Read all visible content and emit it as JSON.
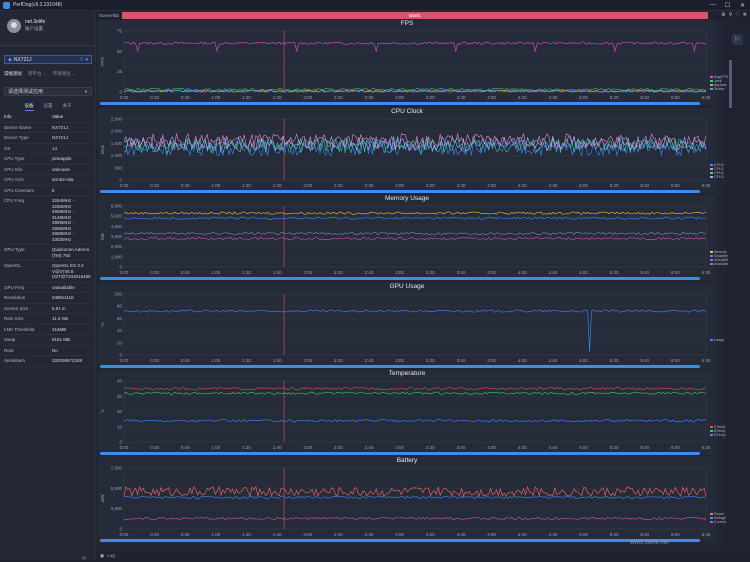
{
  "window": {
    "title": "PerfDog(v9.3.231048)",
    "minimize": "—",
    "maximize": "☐",
    "close": "✕"
  },
  "user": {
    "name": "net.3elife",
    "account": "账户设置"
  },
  "device": {
    "name": "NX721J"
  },
  "mode_tabs": [
    "常规测试",
    "跨平台 ...",
    "环境测试 ..."
  ],
  "app_select": {
    "placeholder": "请选择测试应用"
  },
  "info_tabs": [
    "设备",
    "设置",
    "关于"
  ],
  "info_header": {
    "k": "Info",
    "v": "Value"
  },
  "info_rows": [
    {
      "k": "Device Name",
      "v": "NX721J"
    },
    {
      "k": "Device Type",
      "v": "NX721J"
    },
    {
      "k": "OS",
      "v": "14"
    },
    {
      "k": "CPU Type",
      "v": "pineapple"
    },
    {
      "k": "CPU Info",
      "v": "unknown"
    },
    {
      "k": "CPU Arch",
      "v": "arm64-v8a"
    },
    {
      "k": "CPU CoreNum",
      "v": "8"
    },
    {
      "k": "CPU Freq",
      "v": "3264MHz - 3265MHz\n4959MHz - 3148MHz\n4959MHz - 2956MHz\n4959MHz - 3302MHz"
    },
    {
      "k": "GPU Type",
      "v": "Qualcomm Adreno\n(TM) 750"
    },
    {
      "k": "OpenGL",
      "v": "OpenGL ES 3.2\nV@0746.8\n(GIT@7343016468"
    },
    {
      "k": "GPU Freq",
      "v": "unavailable"
    },
    {
      "k": "Resolution",
      "v": "2480x1116"
    },
    {
      "k": "Screen Size",
      "v": "6.81 in"
    },
    {
      "k": "Ram Size",
      "v": "11.0 GB"
    },
    {
      "k": "LMK Threshold",
      "v": "216MB"
    },
    {
      "k": "Swap",
      "v": "6191 MB"
    },
    {
      "k": "Root",
      "v": "No"
    },
    {
      "k": "SerialNum",
      "v": "328336672348"
    }
  ],
  "topbar": {
    "scene": "SceneTab",
    "label": "label1"
  },
  "bottombar": {
    "log": "Log"
  },
  "watermark": "www.3elife.net",
  "time_ticks": [
    "0:00",
    "0:20",
    "0:40",
    "1:00",
    "1:20",
    "1:40",
    "2:00",
    "2:20",
    "2:40",
    "3:00",
    "3:20",
    "3:40",
    "4:00",
    "4:20",
    "4:40",
    "5:00",
    "5:20",
    "5:40",
    "6:00",
    "6:25"
  ],
  "chart_data": [
    {
      "type": "line",
      "title": "FPS",
      "ylabel": "FPS",
      "ylim": [
        0,
        75
      ],
      "yticks": [
        "75",
        "50",
        "25",
        "0"
      ],
      "series": [
        {
          "name": "Avg(FPS)",
          "color": "#e64be0",
          "level": 60
        },
        {
          "name": "Jank",
          "color": "#2fd36a",
          "level": 3
        },
        {
          "name": "BigJank",
          "color": "#f0a03a",
          "level": 1
        },
        {
          "name": "Stutter",
          "color": "#5aa0ff",
          "level": 1
        }
      ]
    },
    {
      "type": "line",
      "title": "CPU Clock",
      "ylabel": "MHz",
      "ylim": [
        0,
        2500
      ],
      "yticks": [
        "2,500",
        "2,000",
        "1,500",
        "1,000",
        "500",
        "0"
      ],
      "series": [
        {
          "name": "CPU0",
          "color": "#3f8bff",
          "level": 1300
        },
        {
          "name": "CPU1",
          "color": "#f08ac0",
          "level": 1600
        },
        {
          "name": "CPU2",
          "color": "#2fd3a0",
          "level": 1400
        },
        {
          "name": "CPU3",
          "color": "#b0a4ff",
          "level": 1500
        }
      ]
    },
    {
      "type": "line",
      "title": "Memory Usage",
      "ylabel": "MB",
      "ylim": [
        0,
        6000
      ],
      "yticks": [
        "6,000",
        "5,000",
        "4,000",
        "3,000",
        "2,000",
        "1,000",
        "0"
      ],
      "series": [
        {
          "name": "Memory",
          "color": "#f0c23a",
          "level": 5300
        },
        {
          "name": "SwapMemory",
          "color": "#3f8bff",
          "level": 4800
        },
        {
          "name": "VirtualMemory",
          "color": "#d050c8",
          "level": 2800
        },
        {
          "name": "AvailableMemory",
          "color": "#888ea0",
          "level": 3300
        }
      ]
    },
    {
      "type": "line",
      "title": "GPU Usage",
      "ylabel": "%",
      "ylim": [
        0,
        100
      ],
      "yticks": [
        "100",
        "80",
        "60",
        "40",
        "20",
        "0"
      ],
      "series": [
        {
          "name": "Usage",
          "color": "#3f8bff",
          "level": 72
        }
      ]
    },
    {
      "type": "line",
      "title": "Temperature",
      "ylabel": "°C",
      "ylim": [
        0,
        40
      ],
      "yticks": [
        "40",
        "30",
        "20",
        "10",
        "0"
      ],
      "series": [
        {
          "name": "CTemp",
          "color": "#e05050",
          "level": 35
        },
        {
          "name": "BTemp",
          "color": "#2fd36a",
          "level": 32
        },
        {
          "name": "GTemp",
          "color": "#3f8bff",
          "level": 14
        }
      ]
    },
    {
      "type": "line",
      "title": "Battery",
      "ylabel": "mW",
      "ylim": [
        0,
        7500
      ],
      "yticks": [
        "7,500",
        "5,000",
        "2,500",
        "0"
      ],
      "series": [
        {
          "name": "Power",
          "color": "#ff6a5a",
          "level": 4600
        },
        {
          "name": "Voltage",
          "color": "#3f8bff",
          "level": 3900
        },
        {
          "name": "Current",
          "color": "#d050c8",
          "level": 1300
        }
      ]
    }
  ]
}
